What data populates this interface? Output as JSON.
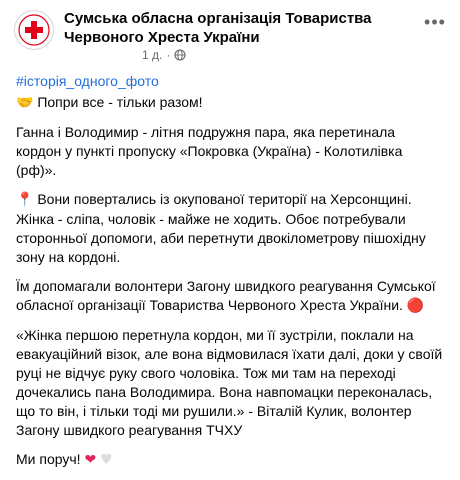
{
  "post": {
    "author": "Сумська обласна організація Товариства Червоного Хреста України",
    "time": "1 д.",
    "hashtag": "#історія_одного_фото",
    "line1": "Попри все - тільки разом!",
    "para1": "Ганна і Володимир - літня подружня пара, яка перетинала кордон у пункті пропуску «Покровка (Україна) - Колотилівка (рф)».",
    "para2": "Вони повертались із окупованої території на Херсонщині. Жінка - сліпа, чоловік - майже не ходить. Обоє потребували сторонньої допомоги, аби перетнути двокілометрову пішохідну зону на кордоні.",
    "para3": "Їм допомагали волонтери Загону швидкого реагування Сумської обласної організації Товариства Червоного Хреста України.",
    "para4": "«Жінка першою перетнула кордон, ми її зустріли, поклали на евакуаційний візок, але вона відмовилася їхати далі, доки у своїй руці не відчує руку свого чоловіка. Тож ми там на переході дочекались пана Володимира. Вона навпомацки переконалась, що то він, і тільки тоді ми рушили.» - Віталій Кулик, волонтер Загону швидкого реагування ТЧХУ",
    "closing": "Ми поруч!"
  },
  "icons": {
    "globe": "globe-icon",
    "more": "more-options-icon",
    "handshake": "handshake-emoji",
    "pin": "pushpin-emoji",
    "redball": "red-ball-emoji",
    "red_heart": "red-heart-emoji",
    "white_heart": "white-heart-emoji"
  },
  "colors": {
    "link": "#216fdb",
    "brand_red": "#e3001b",
    "text": "#050505",
    "meta": "#65676b"
  }
}
